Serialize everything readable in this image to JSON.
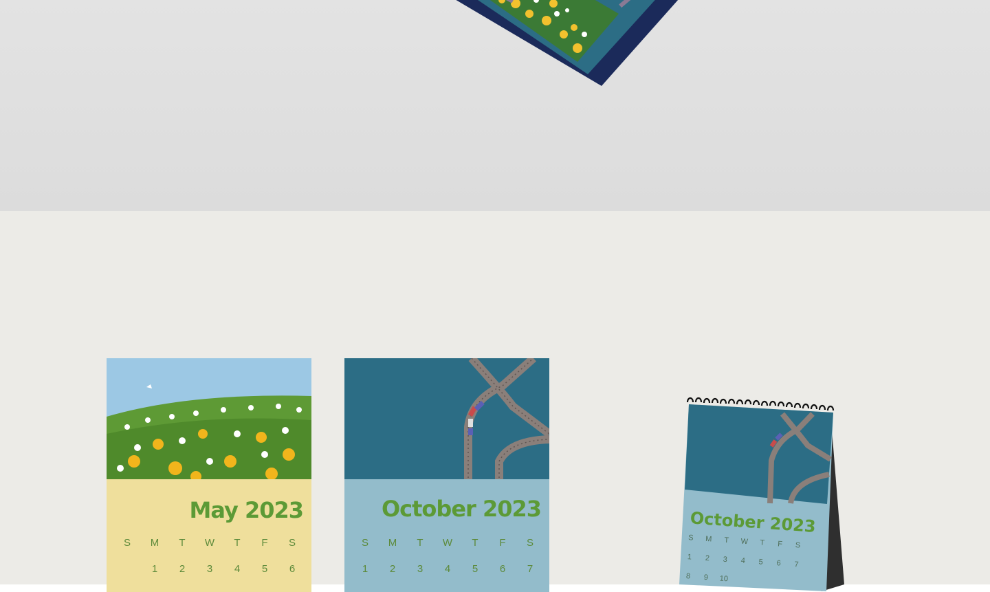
{
  "calendars": [
    {
      "title": "May 2023",
      "weekdays": [
        "S",
        "M",
        "T",
        "W",
        "T",
        "F",
        "S"
      ],
      "days": [
        "",
        "1",
        "2",
        "3",
        "4",
        "5",
        "6"
      ],
      "colors": {
        "bottom": "#efdf9c",
        "title": "#5c9a36",
        "sky": "#9cc8e4"
      }
    },
    {
      "title": "October 2023",
      "weekdays": [
        "S",
        "M",
        "T",
        "W",
        "T",
        "F",
        "S"
      ],
      "days": [
        "1",
        "2",
        "3",
        "4",
        "5",
        "6",
        "7"
      ],
      "colors": {
        "bottom": "#93bccb",
        "title": "#5c9a36",
        "top": "#2c6d85"
      }
    }
  ],
  "desk_calendar": {
    "title": "October 2023",
    "weekdays": [
      "S",
      "M",
      "T",
      "W",
      "T",
      "F",
      "S"
    ],
    "days": [
      "1",
      "2",
      "3",
      "4",
      "5",
      "6",
      "7"
    ],
    "next_days": [
      "8",
      "9",
      "10"
    ],
    "colors": {
      "top": "#2c6d85",
      "bottom": "#93bccb",
      "stand": "#2f2f2f"
    }
  }
}
